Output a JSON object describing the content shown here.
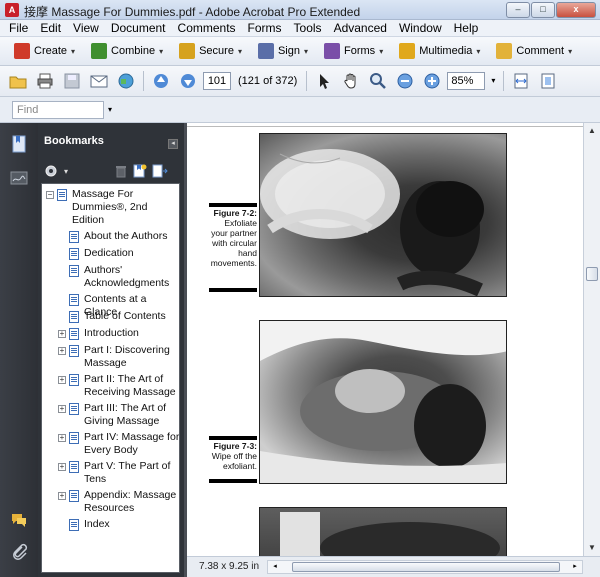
{
  "window": {
    "title": "接摩 Massage For Dummies.pdf - Adobe Acrobat Pro Extended",
    "controls": {
      "minimize": "–",
      "maximize": "□",
      "close": "x"
    }
  },
  "menu": [
    "File",
    "Edit",
    "View",
    "Document",
    "Comments",
    "Forms",
    "Tools",
    "Advanced",
    "Window",
    "Help"
  ],
  "tasks": [
    {
      "label": "Create",
      "icon": "create-icon",
      "color": "#cf3a2a"
    },
    {
      "label": "Combine",
      "icon": "combine-icon",
      "color": "#3f8f2f"
    },
    {
      "label": "Secure",
      "icon": "lock-icon",
      "color": "#d6a21e"
    },
    {
      "label": "Sign",
      "icon": "pen-icon",
      "color": "#5a6ea8"
    },
    {
      "label": "Forms",
      "icon": "form-icon",
      "color": "#7a4fa8"
    },
    {
      "label": "Multimedia",
      "icon": "multimedia-icon",
      "color": "#e0a81c"
    },
    {
      "label": "Comment",
      "icon": "comment-icon",
      "color": "#e2b23a"
    }
  ],
  "nav": {
    "current_page": "101",
    "page_count": "(121 of 372)",
    "zoom": "85%"
  },
  "find": {
    "placeholder": "Find"
  },
  "bookmarks": {
    "header": "Bookmarks",
    "close": "◂",
    "items": [
      {
        "label": "Massage For Dummies®, 2nd Edition",
        "lines": [
          "Massage For",
          "Dummies®, 2nd",
          "Edition"
        ],
        "level": 0,
        "expander": "−"
      },
      {
        "label": "About the Authors",
        "lines": [
          "About the Authors"
        ],
        "level": 1,
        "expander": ""
      },
      {
        "label": "Dedication",
        "lines": [
          "Dedication"
        ],
        "level": 1,
        "expander": ""
      },
      {
        "label": "Authors' Acknowledgments",
        "lines": [
          "Authors'",
          "Acknowledgments"
        ],
        "level": 1,
        "expander": ""
      },
      {
        "label": "Contents at a Glance",
        "lines": [
          "Contents at a Glance"
        ],
        "level": 1,
        "expander": ""
      },
      {
        "label": "Table of Contents",
        "lines": [
          "Table of Contents"
        ],
        "level": 1,
        "expander": ""
      },
      {
        "label": "Introduction",
        "lines": [
          "Introduction"
        ],
        "level": 1,
        "expander": "+"
      },
      {
        "label": "Part I: Discovering Massage",
        "lines": [
          "Part I: Discovering",
          "Massage"
        ],
        "level": 1,
        "expander": "+"
      },
      {
        "label": "Part II: The Art of Receiving Massage",
        "lines": [
          "Part II: The Art of",
          "Receiving Massage"
        ],
        "level": 1,
        "expander": "+"
      },
      {
        "label": "Part III: The Art of Giving Massage",
        "lines": [
          "Part III: The Art of",
          "Giving Massage"
        ],
        "level": 1,
        "expander": "+"
      },
      {
        "label": "Part IV: Massage for Every Body",
        "lines": [
          "Part IV: Massage for",
          "Every Body"
        ],
        "level": 1,
        "expander": "+"
      },
      {
        "label": "Part V: The Part of Tens",
        "lines": [
          "Part V: The Part of",
          "Tens"
        ],
        "level": 1,
        "expander": "+"
      },
      {
        "label": "Appendix: Massage Resources",
        "lines": [
          "Appendix: Massage",
          "Resources"
        ],
        "level": 1,
        "expander": "+"
      },
      {
        "label": "Index",
        "lines": [
          "Index"
        ],
        "level": 1,
        "expander": ""
      }
    ]
  },
  "document": {
    "figures": [
      {
        "fig": "Figure 7-2:",
        "lines": [
          "Exfoliate",
          "your partner",
          "with circular",
          "hand",
          "movements."
        ]
      },
      {
        "fig": "Figure 7-3:",
        "lines": [
          "Wipe off the",
          "exfoliant."
        ]
      }
    ]
  },
  "status": {
    "page_size": "7.38 x 9.25 in"
  }
}
